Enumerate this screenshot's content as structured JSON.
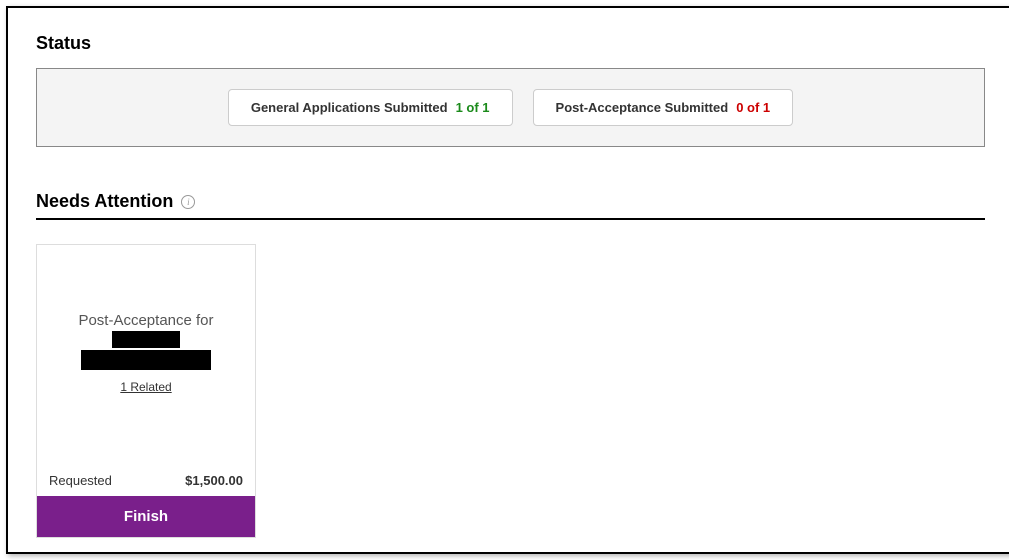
{
  "status": {
    "heading": "Status",
    "pills": [
      {
        "label": "General Applications Submitted",
        "count": "1 of 1",
        "status": "complete"
      },
      {
        "label": "Post-Acceptance Submitted",
        "count": "0 of 1",
        "status": "incomplete"
      }
    ]
  },
  "needs_attention": {
    "heading": "Needs Attention",
    "info_glyph": "i"
  },
  "card": {
    "title_prefix": "Post-Acceptance for",
    "related_link": "1 Related",
    "requested_label": "Requested",
    "requested_amount": "$1,500.00",
    "finish_label": "Finish"
  }
}
